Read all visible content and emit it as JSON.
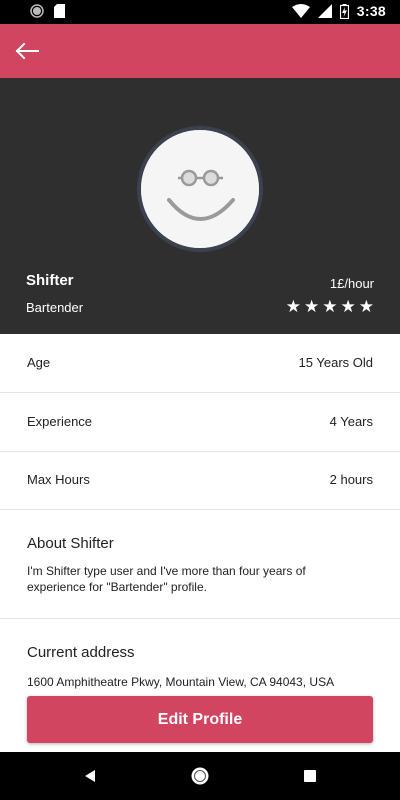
{
  "status_bar": {
    "time": "3:38",
    "icons": [
      "record-icon",
      "sd-card-icon",
      "wifi-icon",
      "signal-icon",
      "battery-charging-icon"
    ]
  },
  "app_bar": {
    "background": "#d24560",
    "back_icon": "arrow-left-icon"
  },
  "profile": {
    "name": "Shifter",
    "role": "Bartender",
    "rate": "1£/hour",
    "rating": 5,
    "rating_max": 5,
    "avatar_icon": "smiley-glasses-icon"
  },
  "details": [
    {
      "label": "Age",
      "value": "15 Years Old"
    },
    {
      "label": "Experience",
      "value": "4 Years"
    },
    {
      "label": "Max Hours",
      "value": "2 hours"
    }
  ],
  "about": {
    "title": "About Shifter",
    "text": "I'm Shifter type user and I've more than four years of experience for \"Bartender\" profile."
  },
  "address": {
    "title": "Current address",
    "text": "1600 Amphitheatre Pkwy, Mountain View, CA 94043, USA"
  },
  "actions": {
    "edit_label": "Edit Profile"
  },
  "nav_bar": {
    "icons": [
      "back-triangle-icon",
      "home-circle-icon",
      "recents-square-icon"
    ]
  }
}
